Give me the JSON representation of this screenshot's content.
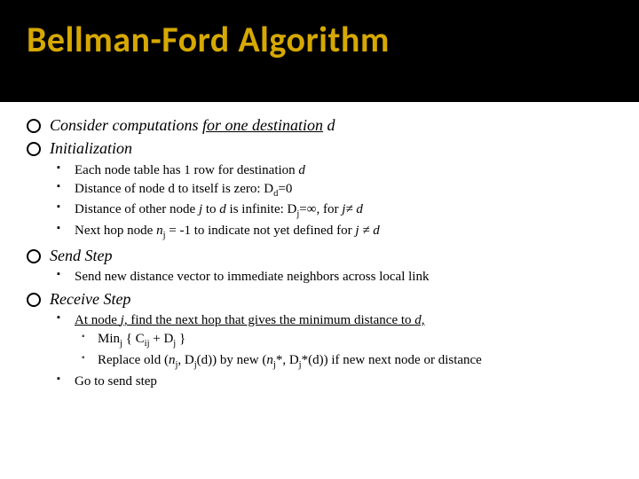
{
  "title": "Bellman-Ford Algorithm",
  "b1": {
    "consider_a": "Consider computations ",
    "consider_b": "for one destination",
    "consider_c": " d",
    "init": "Initialization",
    "send": "Send Step",
    "recv": "Receive Step"
  },
  "init": {
    "i1_a": "Each node table has 1 row for destination ",
    "i1_b": "d",
    "i2": "Distance of node d to itself is zero:  D",
    "i2_sub": "d",
    "i2_tail": "=0",
    "i3_a": "Distance of other node ",
    "i3_b": "j",
    "i3_c": " to ",
    "i3_d": "d",
    "i3_e": " is infinite:  D",
    "i3_sub": "j",
    "i3_f": "=∞, for ",
    "i3_g": "j≠ d",
    "i4_a": "Next hop node ",
    "i4_b": "n",
    "i4_sub": "j",
    "i4_c": " = -1 to indicate not yet defined for ",
    "i4_d": "j ≠ d"
  },
  "send": {
    "s1": "Send new distance vector to immediate neighbors across local link"
  },
  "recv": {
    "r1_a": "At node ",
    "r1_b": "j",
    "r1_c": ", find the next hop that gives the minimum distance to ",
    "r1_d": "d,",
    "r1_sub1_a": "Min",
    "r1_sub1_sub": "j",
    "r1_sub1_b": " { C",
    "r1_sub1_sub2": "ij",
    "r1_sub1_c": " + D",
    "r1_sub1_sub3": "j",
    "r1_sub1_d": " }",
    "r1_sub2_a": "Replace old (",
    "r1_sub2_b": "n",
    "r1_sub2_sub1": "j",
    "r1_sub2_c": ", D",
    "r1_sub2_sub2": "j",
    "r1_sub2_d": "(d)) by new (",
    "r1_sub2_e": "n",
    "r1_sub2_sub3": "j",
    "r1_sub2_f": "*, D",
    "r1_sub2_sub4": "j",
    "r1_sub2_g": "*(d)) if new next node or distance",
    "r2": "Go to send step"
  }
}
